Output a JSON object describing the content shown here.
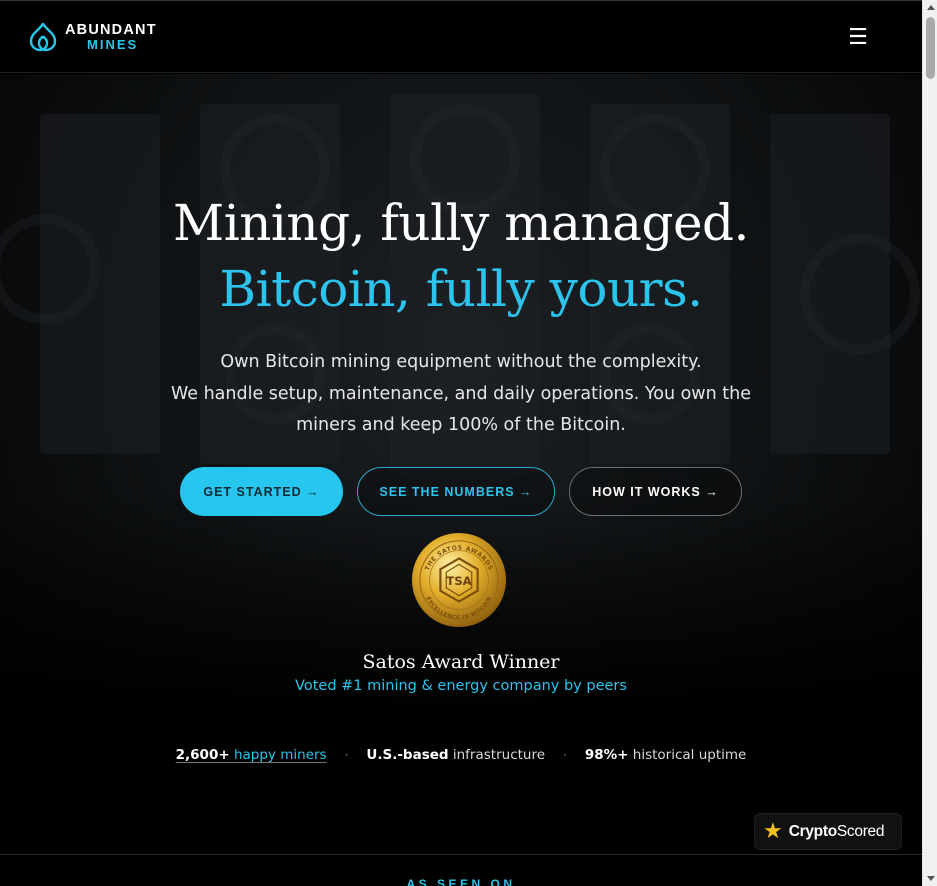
{
  "header": {
    "logo": {
      "line1": "ABUNDANT",
      "line2": "MINES",
      "icon": "droplet-logo-icon"
    },
    "menu_icon": "☰"
  },
  "hero": {
    "headline_line1": "Mining, fully managed.",
    "headline_line2": "Bitcoin, fully yours.",
    "subtext_line1": "Own Bitcoin mining equipment without the complexity.",
    "subtext_line2": "We handle setup, maintenance, and daily operations. You own the miners and keep 100% of the Bitcoin.",
    "buttons": [
      {
        "label": "GET STARTED →",
        "style": "primary"
      },
      {
        "label": "SEE THE NUMBERS →",
        "style": "outline-blue"
      },
      {
        "label": "HOW IT WORKS →",
        "style": "outline-white"
      }
    ],
    "award": {
      "medal_icon": "satos-award-medal-icon",
      "medal_text_top": "THE SATOS AWARDS",
      "medal_text_bottom": "EXCELLENCE IN BITCOIN",
      "medal_monogram": "TSA",
      "title": "Satos Award Winner",
      "subtitle": "Voted #1 mining & energy company by peers"
    },
    "stats": [
      {
        "value": "2,600+",
        "label": "happy miners"
      },
      {
        "value": "U.S.-based",
        "label": "infrastructure"
      },
      {
        "value": "98%+",
        "label": "historical uptime"
      }
    ],
    "separator": "·"
  },
  "cryptoscored": {
    "star": "★",
    "brand_bold": "Crypto",
    "brand_rest": "Scored"
  },
  "seen_on": {
    "label": "AS SEEN ON"
  },
  "colors": {
    "accent": "#29c6ea",
    "background": "#000000",
    "gold": "#d9a21b"
  }
}
